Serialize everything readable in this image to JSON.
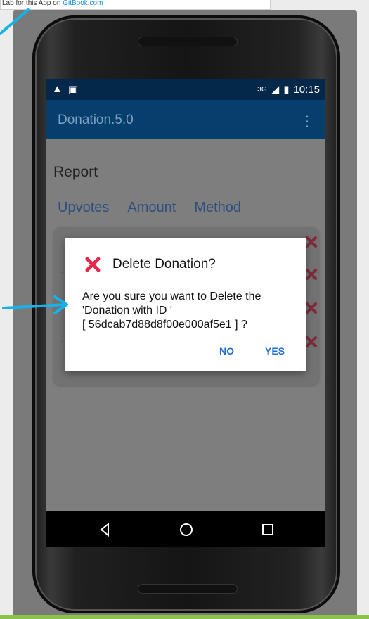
{
  "header_note": {
    "text": "Lab for this App on",
    "link": "GitBook.com"
  },
  "status": {
    "time": "10:15",
    "network": "3G"
  },
  "app": {
    "title": "Donation.5.0",
    "menu_icon": "overflow-menu-icon"
  },
  "report": {
    "title": "Report",
    "columns": [
      "Upvotes",
      "Amount",
      "Method"
    ]
  },
  "dialog": {
    "title": "Delete Donation?",
    "message_line1": "Are you sure you want to Delete the",
    "message_line2": "'Donation with ID '",
    "message_line3": " [ 56dcab7d88d8f00e000af5e1 ] ?",
    "no": "NO",
    "yes": "YES"
  },
  "colors": {
    "accent": "#e7284b",
    "appbar": "#063e6e",
    "status": "#04284a",
    "button": "#1f6dd1"
  }
}
